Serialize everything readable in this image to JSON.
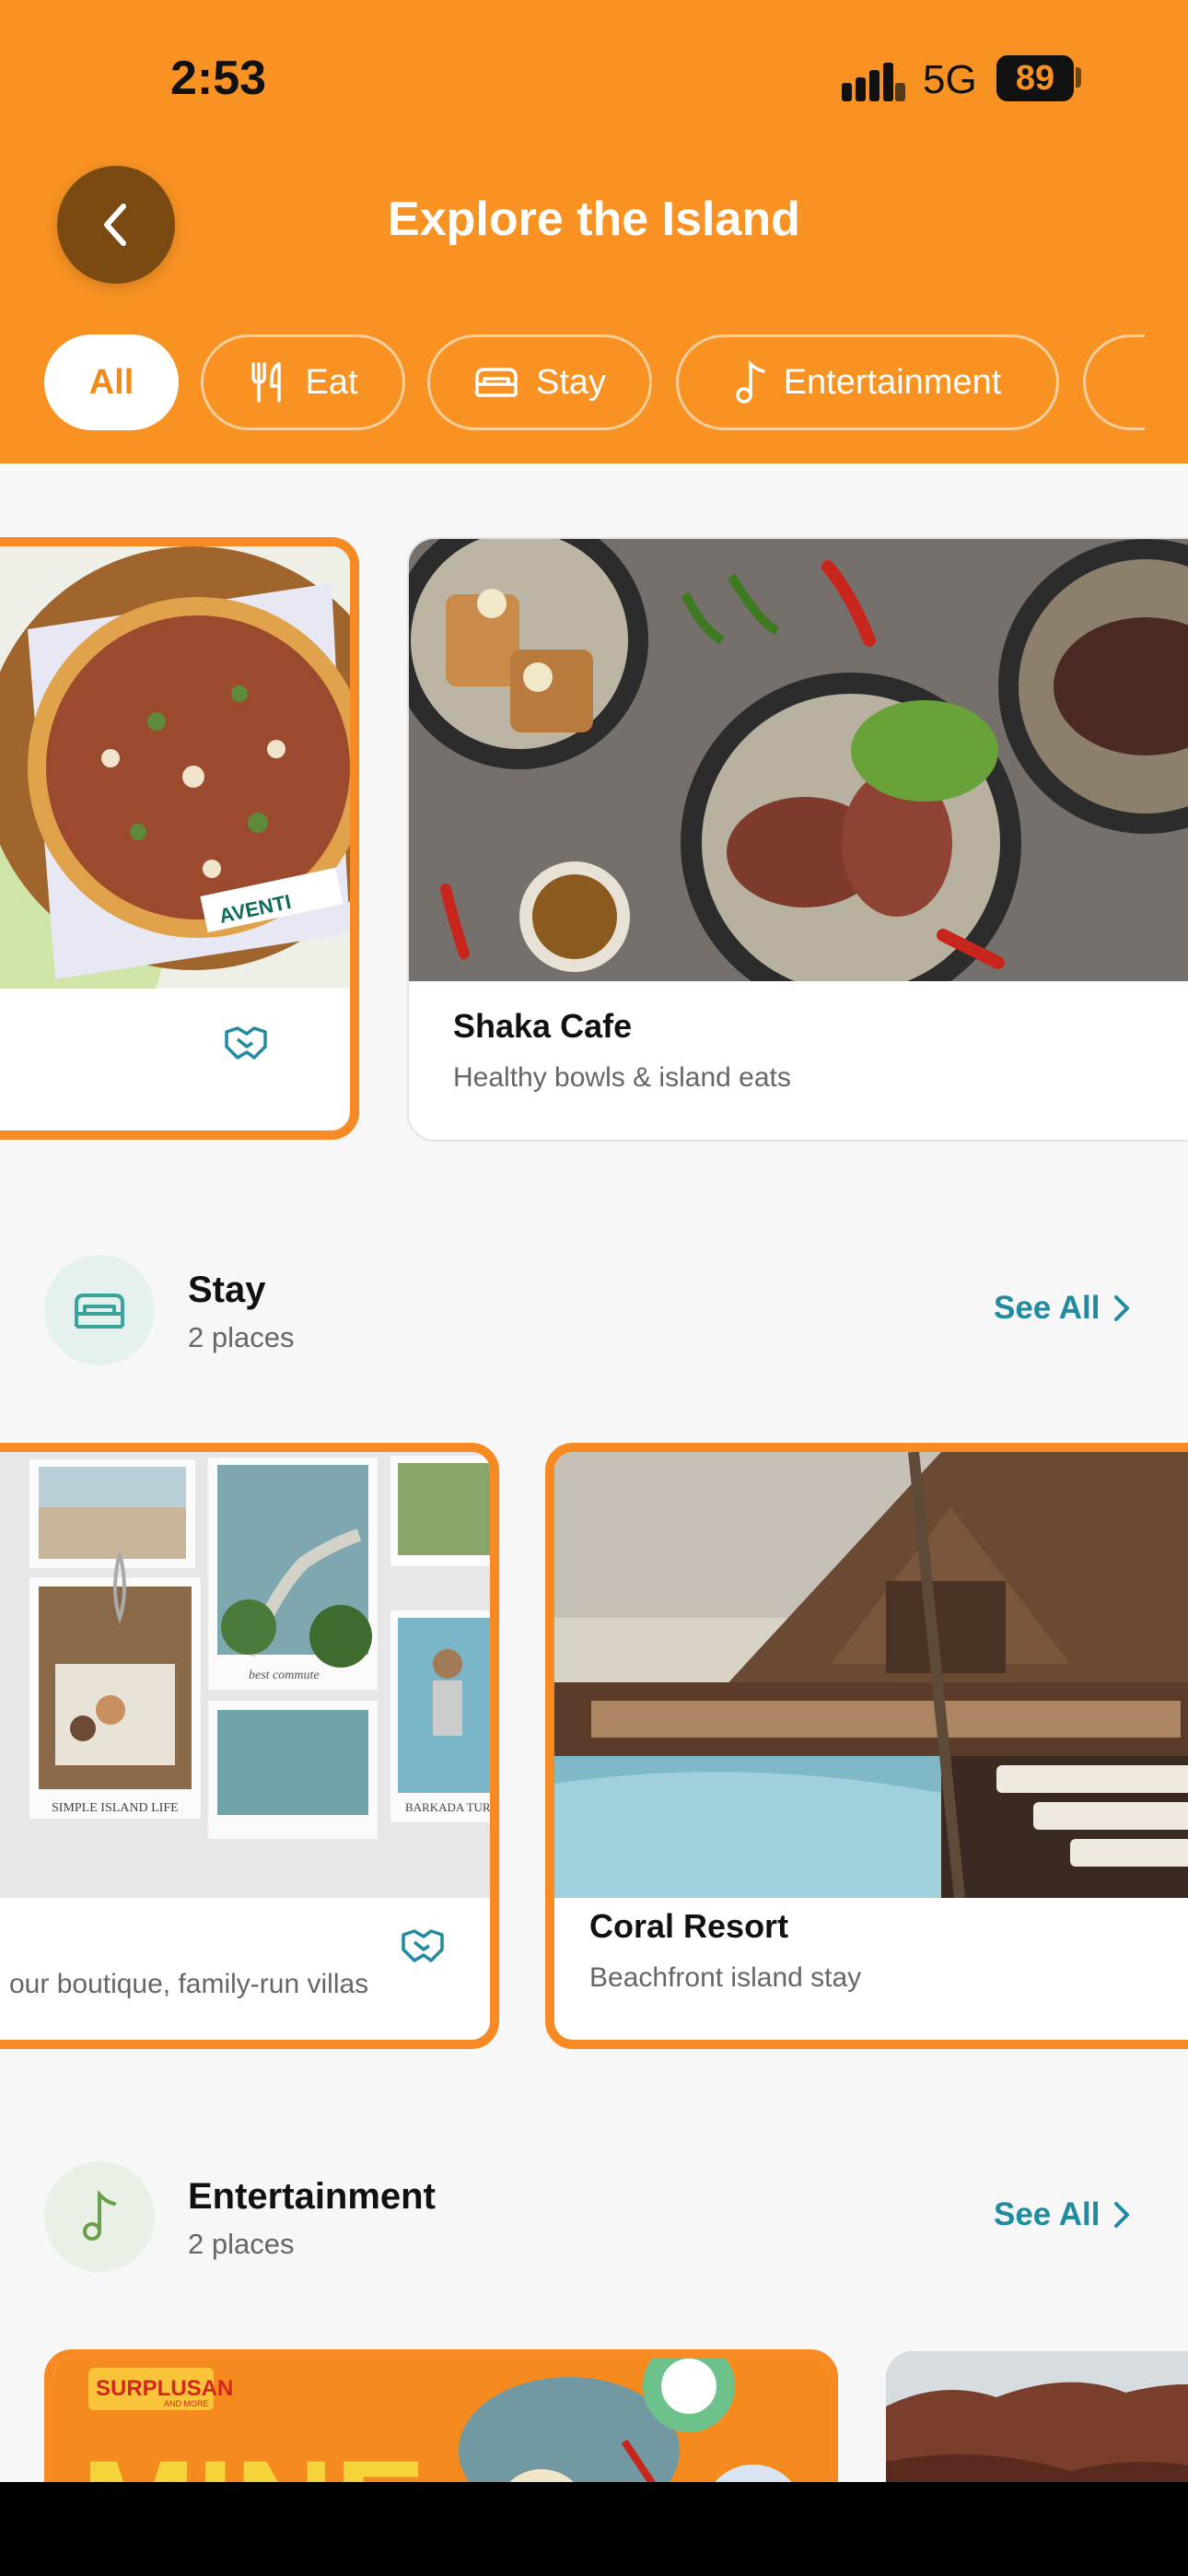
{
  "status_bar": {
    "time": "2:53",
    "network": "5G",
    "battery": "89"
  },
  "header": {
    "title": "Explore the Island"
  },
  "filters": [
    {
      "label": "All",
      "icon": ""
    },
    {
      "label": "Eat",
      "icon": "fork-knife-icon"
    },
    {
      "label": "Stay",
      "icon": "bed-icon"
    },
    {
      "label": "Entertainment",
      "icon": "music-note-icon"
    }
  ],
  "eat_cards": [
    {
      "title": "",
      "subtitle": "",
      "badge_icon": "handshake-icon",
      "highlighted": true
    },
    {
      "title": "Shaka Cafe",
      "subtitle": "Healthy bowls & island eats",
      "highlighted": false
    }
  ],
  "stay": {
    "title": "Stay",
    "count": "2 places",
    "see_all": "See All",
    "icon": "bed-icon",
    "cards": [
      {
        "title": "",
        "subtitle": "our boutique, family-run villas",
        "badge_icon": "handshake-icon",
        "highlighted": true,
        "photo_captions": [
          "best commute",
          "SIMPLE ISLAND LIFE",
          "BARKADA TURNED"
        ]
      },
      {
        "title": "Coral Resort",
        "subtitle": "Beachfront island stay",
        "highlighted": true
      }
    ]
  },
  "entertainment": {
    "title": "Entertainment",
    "count": "2 places",
    "see_all": "See All",
    "icon": "music-note-icon",
    "cards": [
      {
        "logo_text": "SURPLUSAN",
        "logo_sub": "AND MORE",
        "banner_text": "MINE"
      }
    ]
  },
  "pizza_label": "AVENTI",
  "colors": {
    "header": "#f79223",
    "accent": "#f78a22",
    "link": "#1f8aa0",
    "stay_icon_bg": "#e4f1ee",
    "ent_icon_bg": "#e9f1e6"
  }
}
